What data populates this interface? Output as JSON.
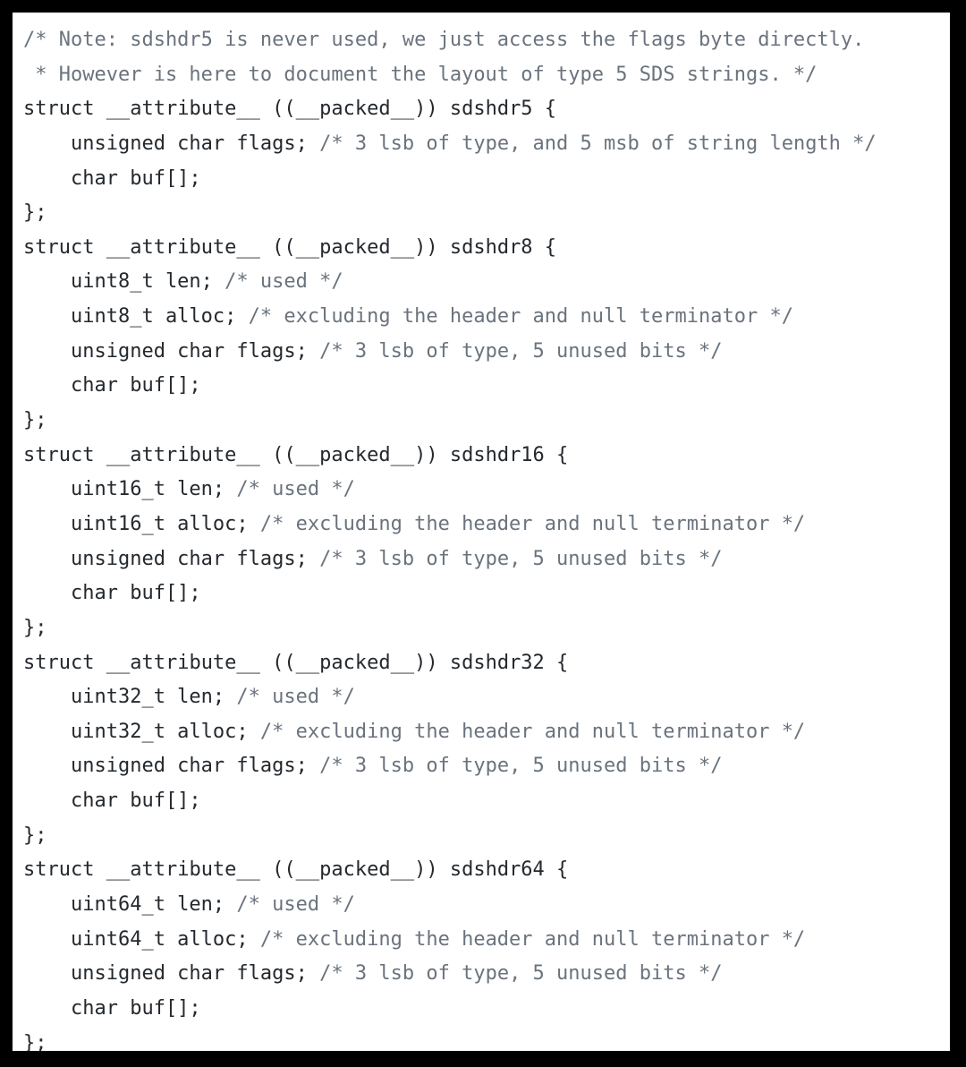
{
  "window": {
    "kind": "code-snippet-image",
    "border_color": "#000000",
    "panel_background": "#ffffff"
  },
  "theme": {
    "keyword_color": "#b5302c",
    "code_color": "#24292e",
    "comment_color": "#6a737d",
    "background_color": "#ffffff",
    "frame_color": "#000000"
  },
  "code": {
    "language": "c",
    "indent": "    ",
    "lines": [
      {
        "n": 1,
        "tokens": [
          {
            "t": "comment",
            "s": "/* Note: sdshdr5 is never used, we just access the flags byte directly."
          }
        ]
      },
      {
        "n": 2,
        "tokens": [
          {
            "t": "comment",
            "s": " * However is here to document the layout of type 5 SDS strings. */"
          }
        ]
      },
      {
        "n": 3,
        "tokens": [
          {
            "t": "keyword",
            "s": "struct"
          },
          {
            "t": "code",
            "s": " __attribute__ ((__packed__)) sdshdr5 {"
          }
        ]
      },
      {
        "n": 4,
        "tokens": [
          {
            "t": "code",
            "s": "    unsigned char flags; "
          },
          {
            "t": "comment",
            "s": "/* 3 lsb of type, and 5 msb of string length */"
          }
        ]
      },
      {
        "n": 5,
        "tokens": [
          {
            "t": "code",
            "s": "    char buf[];"
          }
        ]
      },
      {
        "n": 6,
        "tokens": [
          {
            "t": "code",
            "s": "};"
          }
        ]
      },
      {
        "n": 7,
        "tokens": [
          {
            "t": "keyword",
            "s": "struct"
          },
          {
            "t": "code",
            "s": " __attribute__ ((__packed__)) sdshdr8 {"
          }
        ]
      },
      {
        "n": 8,
        "tokens": [
          {
            "t": "code",
            "s": "    uint8_t len; "
          },
          {
            "t": "comment",
            "s": "/* used */"
          }
        ]
      },
      {
        "n": 9,
        "tokens": [
          {
            "t": "code",
            "s": "    uint8_t alloc; "
          },
          {
            "t": "comment",
            "s": "/* excluding the header and null terminator */"
          }
        ]
      },
      {
        "n": 10,
        "tokens": [
          {
            "t": "code",
            "s": "    unsigned char flags; "
          },
          {
            "t": "comment",
            "s": "/* 3 lsb of type, 5 unused bits */"
          }
        ]
      },
      {
        "n": 11,
        "tokens": [
          {
            "t": "code",
            "s": "    char buf[];"
          }
        ]
      },
      {
        "n": 12,
        "tokens": [
          {
            "t": "code",
            "s": "};"
          }
        ]
      },
      {
        "n": 13,
        "tokens": [
          {
            "t": "keyword",
            "s": "struct"
          },
          {
            "t": "code",
            "s": " __attribute__ ((__packed__)) sdshdr16 {"
          }
        ]
      },
      {
        "n": 14,
        "tokens": [
          {
            "t": "code",
            "s": "    uint16_t len; "
          },
          {
            "t": "comment",
            "s": "/* used */"
          }
        ]
      },
      {
        "n": 15,
        "tokens": [
          {
            "t": "code",
            "s": "    uint16_t alloc; "
          },
          {
            "t": "comment",
            "s": "/* excluding the header and null terminator */"
          }
        ]
      },
      {
        "n": 16,
        "tokens": [
          {
            "t": "code",
            "s": "    unsigned char flags; "
          },
          {
            "t": "comment",
            "s": "/* 3 lsb of type, 5 unused bits */"
          }
        ]
      },
      {
        "n": 17,
        "tokens": [
          {
            "t": "code",
            "s": "    char buf[];"
          }
        ]
      },
      {
        "n": 18,
        "tokens": [
          {
            "t": "code",
            "s": "};"
          }
        ]
      },
      {
        "n": 19,
        "tokens": [
          {
            "t": "keyword",
            "s": "struct"
          },
          {
            "t": "code",
            "s": " __attribute__ ((__packed__)) sdshdr32 {"
          }
        ]
      },
      {
        "n": 20,
        "tokens": [
          {
            "t": "code",
            "s": "    uint32_t len; "
          },
          {
            "t": "comment",
            "s": "/* used */"
          }
        ]
      },
      {
        "n": 21,
        "tokens": [
          {
            "t": "code",
            "s": "    uint32_t alloc; "
          },
          {
            "t": "comment",
            "s": "/* excluding the header and null terminator */"
          }
        ]
      },
      {
        "n": 22,
        "tokens": [
          {
            "t": "code",
            "s": "    unsigned char flags; "
          },
          {
            "t": "comment",
            "s": "/* 3 lsb of type, 5 unused bits */"
          }
        ]
      },
      {
        "n": 23,
        "tokens": [
          {
            "t": "code",
            "s": "    char buf[];"
          }
        ]
      },
      {
        "n": 24,
        "tokens": [
          {
            "t": "code",
            "s": "};"
          }
        ]
      },
      {
        "n": 25,
        "tokens": [
          {
            "t": "keyword",
            "s": "struct"
          },
          {
            "t": "code",
            "s": " __attribute__ ((__packed__)) sdshdr64 {"
          }
        ]
      },
      {
        "n": 26,
        "tokens": [
          {
            "t": "code",
            "s": "    uint64_t len; "
          },
          {
            "t": "comment",
            "s": "/* used */"
          }
        ]
      },
      {
        "n": 27,
        "tokens": [
          {
            "t": "code",
            "s": "    uint64_t alloc; "
          },
          {
            "t": "comment",
            "s": "/* excluding the header and null terminator */"
          }
        ]
      },
      {
        "n": 28,
        "tokens": [
          {
            "t": "code",
            "s": "    unsigned char flags; "
          },
          {
            "t": "comment",
            "s": "/* 3 lsb of type, 5 unused bits */"
          }
        ]
      },
      {
        "n": 29,
        "tokens": [
          {
            "t": "code",
            "s": "    char buf[];"
          }
        ]
      },
      {
        "n": 30,
        "tokens": [
          {
            "t": "code",
            "s": "};"
          }
        ]
      }
    ]
  }
}
